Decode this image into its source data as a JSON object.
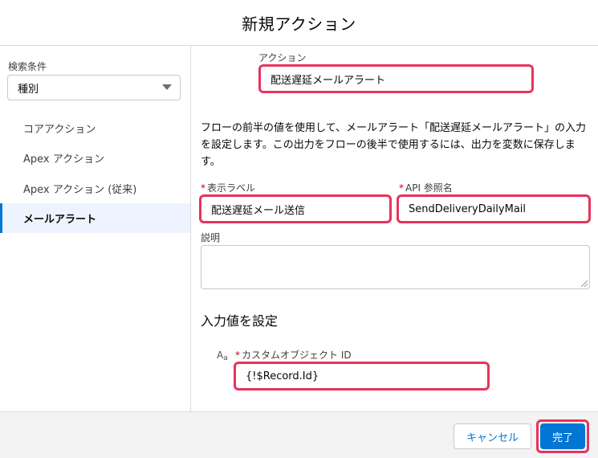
{
  "modal": {
    "title": "新規アクション"
  },
  "sidebar": {
    "filter_label": "検索条件",
    "filter_value": "種別",
    "items": [
      {
        "label": "コアアクション"
      },
      {
        "label": "Apex アクション"
      },
      {
        "label": "Apex アクション (従来)"
      },
      {
        "label": "メールアラート"
      }
    ]
  },
  "main": {
    "action_label": "アクション",
    "action_value": "配送遅延メールアラート",
    "description": "フローの前半の値を使用して、メールアラート「配送遅延メールアラート」の入力を設定します。この出力をフローの後半で使用するには、出力を変数に保存します。",
    "display_label_label": "表示ラベル",
    "display_label_value": "配送遅延メール送信",
    "api_name_label": "API 参照名",
    "api_name_value": "SendDeliveryDailyMail",
    "required_mark": "*",
    "explanation_label": "説明",
    "explanation_value": "",
    "input_section_title": "入力値を設定",
    "input_type_icon": "A",
    "input_type_icon_sub": "a",
    "custom_object_id_label": "カスタムオブジェクト ID",
    "custom_object_id_value": "{!$Record.Id}"
  },
  "footer": {
    "cancel_label": "キャンセル",
    "done_label": "完了"
  },
  "colors": {
    "highlight": "#e8335d",
    "brand": "#0176d3"
  }
}
